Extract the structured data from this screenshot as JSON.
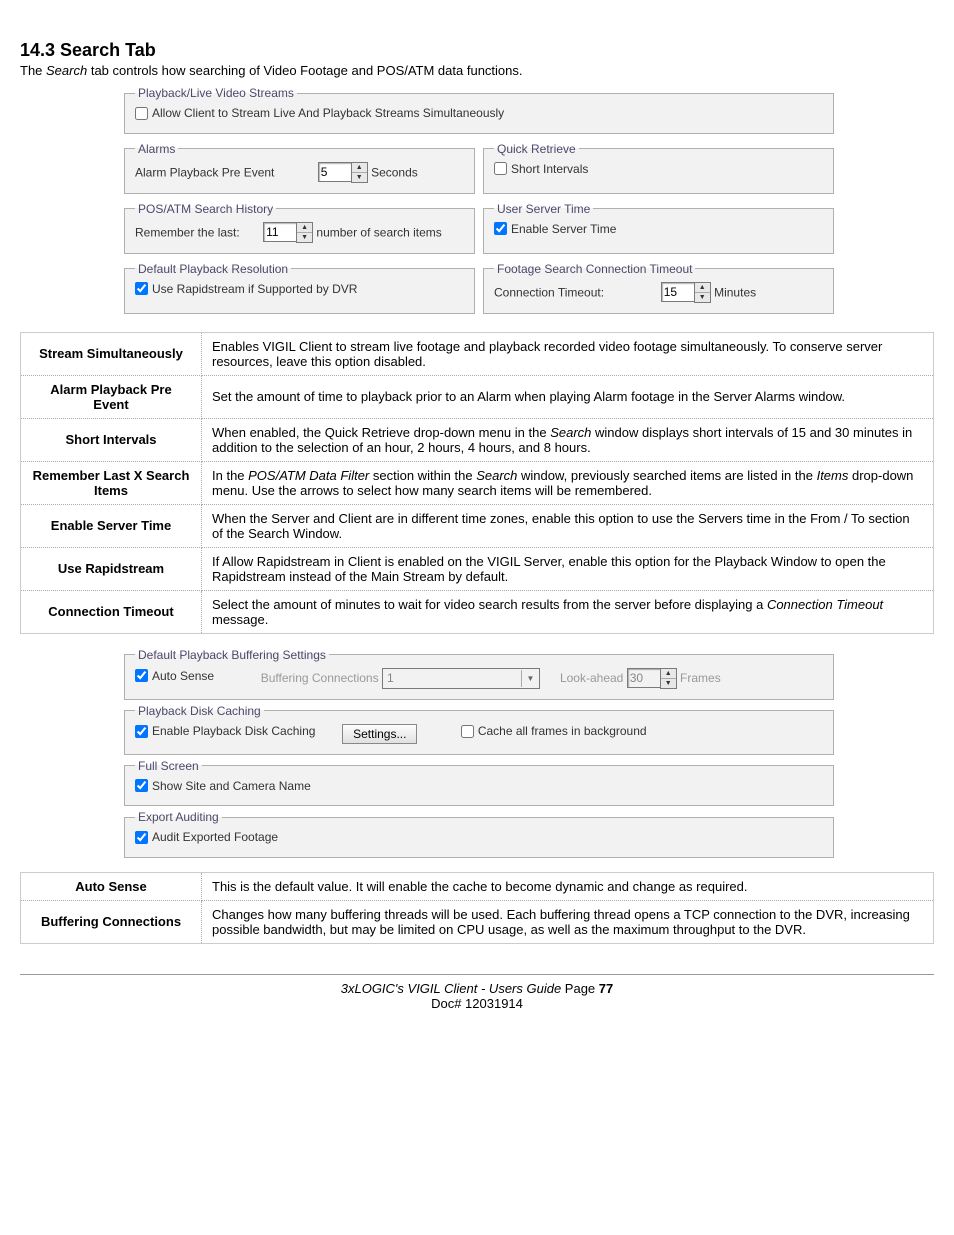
{
  "heading": "14.3       Search Tab",
  "subtitle_pre": "The ",
  "subtitle_i": "Search",
  "subtitle_post": " tab controls how searching of Video Footage and POS/ATM data functions.",
  "p1": {
    "g1": {
      "legend": "Playback/Live Video Streams",
      "cb": "Allow Client to Stream Live And Playback Streams Simultaneously",
      "checked": false
    },
    "g2": {
      "legend": "Alarms",
      "label": "Alarm Playback Pre Event",
      "val": "5",
      "unit": "Seconds"
    },
    "g3": {
      "legend": "Quick Retrieve",
      "cb": "Short Intervals",
      "checked": false
    },
    "g4": {
      "legend": "POS/ATM Search History",
      "label": "Remember the last:",
      "val": "11",
      "unit": "number of search items"
    },
    "g5": {
      "legend": "User Server Time",
      "cb": "Enable Server Time",
      "checked": true
    },
    "g6": {
      "legend": "Default Playback Resolution",
      "cb": "Use Rapidstream if Supported by DVR",
      "checked": true
    },
    "g7": {
      "legend": "Footage Search Connection Timeout",
      "label": "Connection Timeout:",
      "val": "15",
      "unit": "Minutes"
    }
  },
  "t1": [
    {
      "k": "Stream Simultaneously",
      "v": "Enables VIGIL Client to stream live footage and playback recorded video footage simultaneously. To conserve server resources, leave this option disabled."
    },
    {
      "k": "Alarm Playback Pre Event",
      "v": "Set the amount of time to playback prior to an Alarm when playing Alarm footage in the Server Alarms window."
    },
    {
      "k": "Short Intervals",
      "v": "When enabled, the Quick Retrieve drop-down menu in the <i>Search</i> window displays short intervals of 15 and 30 minutes in addition to the selection of an hour, 2 hours, 4 hours, and 8 hours."
    },
    {
      "k": "Remember Last X Search Items",
      "v": "In the <i>POS/ATM Data Filter</i> section within the <i>Search</i> window, previously searched items are listed in the <i>Items</i> drop-down menu. Use the arrows to select how many search items will be remembered."
    },
    {
      "k": "Enable Server Time",
      "v": "When the Server and Client are in different time zones, enable this option to use the Servers time in the From / To section of the Search Window."
    },
    {
      "k": "Use Rapidstream",
      "v": "If Allow Rapidstream in Client is enabled on the VIGIL Server, enable this option for the Playback Window to open the Rapidstream instead of the Main Stream by default."
    },
    {
      "k": "Connection Timeout",
      "v": "Select the amount of minutes to wait for video search results from the server before displaying a <i>Connection Timeout</i> message."
    }
  ],
  "p2": {
    "g1": {
      "legend": "Default Playback Buffering Settings",
      "cb": "Auto Sense",
      "checked": true,
      "bc_lbl": "Buffering Connections",
      "bc_val": "1",
      "la_lbl": "Look-ahead",
      "la_val": "30",
      "la_unit": "Frames"
    },
    "g2": {
      "legend": "Playback Disk Caching",
      "cb1": "Enable Playback Disk Caching",
      "checked1": true,
      "btn": "Settings...",
      "cb2": "Cache all frames in background",
      "checked2": false
    },
    "g3": {
      "legend": "Full Screen",
      "cb": "Show Site and Camera Name",
      "checked": true
    },
    "g4": {
      "legend": "Export Auditing",
      "cb": "Audit Exported Footage",
      "checked": true
    }
  },
  "t2": [
    {
      "k": "Auto Sense",
      "v": "This is the default value. It will enable the cache to become dynamic and change as required."
    },
    {
      "k": "Buffering Connections",
      "v": "Changes how many buffering threads will be used. Each buffering thread opens a TCP connection to the DVR, increasing possible bandwidth, but may be limited on CPU usage, as well as the maximum throughput to the DVR."
    }
  ],
  "footer": {
    "line1_i": "3xLOGIC's VIGIL Client - Users Guide",
    "line1_mid": " Page ",
    "line1_b": "77",
    "line2": "Doc# 12031914"
  }
}
